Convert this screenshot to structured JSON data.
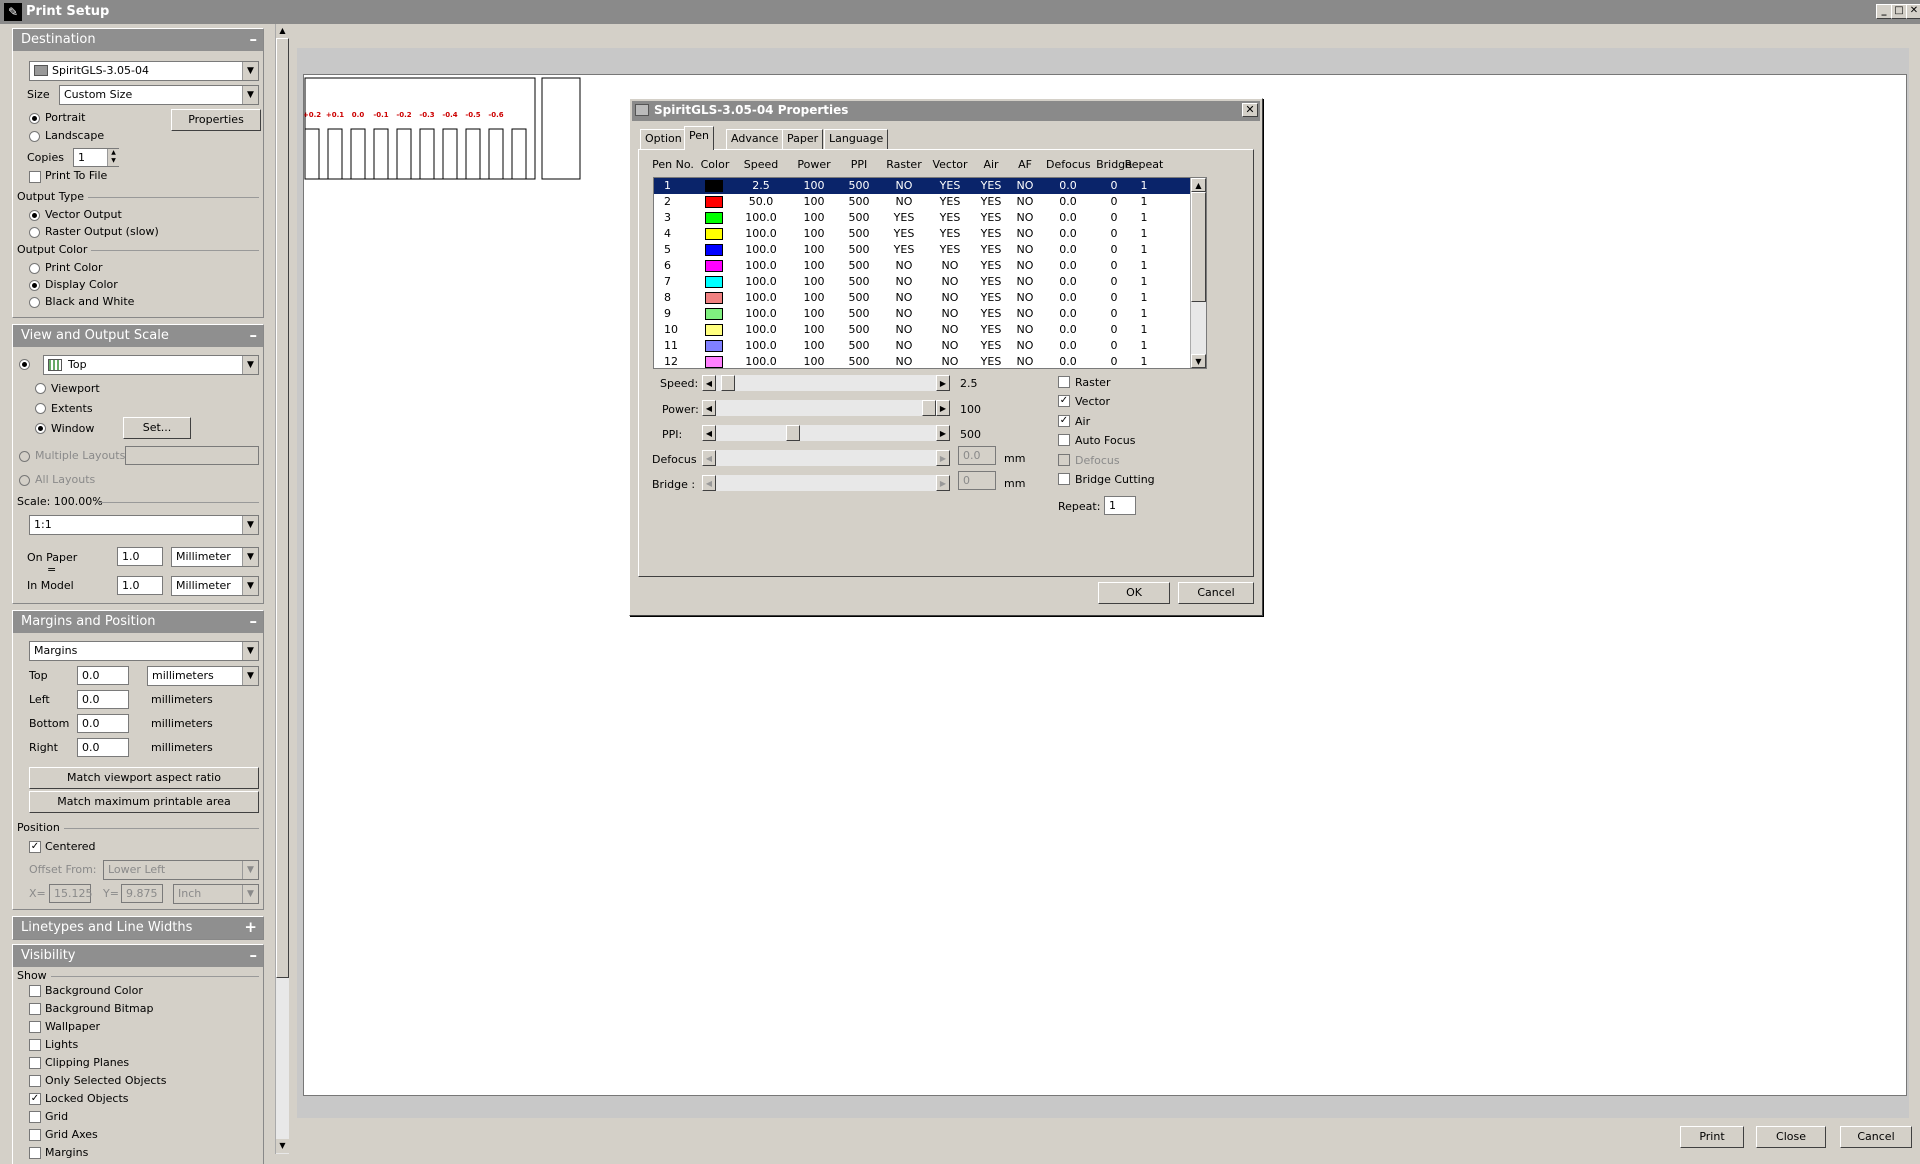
{
  "window": {
    "title": "Print Setup",
    "minimize": "_",
    "maximize": "□",
    "close": "✕"
  },
  "destination": {
    "header": "Destination",
    "toggle": "–",
    "printer": "SpiritGLS-3.05-04",
    "size_label": "Size",
    "size_value": "Custom Size",
    "portrait": "Portrait",
    "landscape": "Landscape",
    "properties_button": "Properties",
    "copies_label": "Copies",
    "copies_value": "1",
    "print_to_file": "Print To File",
    "output_type_label": "Output Type",
    "vector_output": "Vector Output",
    "raster_output": "Raster Output (slow)",
    "output_color_label": "Output Color",
    "print_color": "Print Color",
    "display_color": "Display Color",
    "black_and_white": "Black and White"
  },
  "view": {
    "header": "View and Output Scale",
    "toggle": "–",
    "view_value": "Top",
    "viewport": "Viewport",
    "extents": "Extents",
    "window": "Window",
    "set_button": "Set...",
    "multiple_layouts": "Multiple Layouts",
    "all_layouts": "All Layouts",
    "scale_label": "Scale:  100.00%",
    "scale_value": "1:1",
    "on_paper": "On Paper",
    "equals": "=",
    "in_model": "In Model",
    "on_paper_value": "1.0",
    "on_paper_unit": "Millimeter",
    "in_model_value": "1.0",
    "in_model_unit": "Millimeter"
  },
  "margins": {
    "header": "Margins and Position",
    "toggle": "–",
    "mode": "Margins",
    "top_label": "Top",
    "top_value": "0.0",
    "top_unit": "millimeters",
    "left_label": "Left",
    "left_value": "0.0",
    "left_unit": "millimeters",
    "bottom_label": "Bottom",
    "bottom_value": "0.0",
    "bottom_unit": "millimeters",
    "right_label": "Right",
    "right_value": "0.0",
    "right_unit": "millimeters",
    "match_viewport": "Match viewport aspect ratio",
    "match_max": "Match maximum printable area",
    "position_label": "Position",
    "centered": "Centered",
    "offset_from_label": "Offset From:",
    "offset_from_value": "Lower Left",
    "x_label": "X=",
    "x_value": "15.125",
    "y_label": "Y=",
    "y_value": "9.875",
    "xy_unit": "Inch"
  },
  "linetypes": {
    "header": "Linetypes and Line Widths",
    "toggle": "+"
  },
  "visibility": {
    "header": "Visibility",
    "toggle": "–",
    "show_label": "Show",
    "items": [
      "Background Color",
      "Background Bitmap",
      "Wallpaper",
      "Lights",
      "Clipping Planes",
      "Only Selected Objects",
      "Locked Objects",
      "Grid",
      "Grid Axes",
      "Margins"
    ]
  },
  "preview": {
    "labels": [
      "+0.2",
      "+0.1",
      "0.0",
      "-0.1",
      "-0.2",
      "-0.3",
      "-0.4",
      "-0.5",
      "-0.6"
    ],
    "label_color": "#cc0000"
  },
  "dialog": {
    "title": "SpiritGLS-3.05-04 Properties",
    "close": "✕",
    "tabs": [
      "Option",
      "Pen",
      "Advance",
      "Paper",
      "Language"
    ],
    "columns": [
      "Pen No.",
      "Color",
      "Speed",
      "Power",
      "PPI",
      "Raster",
      "Vector",
      "Air",
      "AF",
      "Defocus",
      "Bridge",
      "Repeat"
    ],
    "rows": [
      {
        "no": "1",
        "color": "#000000",
        "speed": "2.5",
        "power": "100",
        "ppi": "500",
        "raster": "NO",
        "vector": "YES",
        "air": "YES",
        "af": "NO",
        "defocus": "0.0",
        "bridge": "0",
        "repeat": "1"
      },
      {
        "no": "2",
        "color": "#ff0000",
        "speed": "50.0",
        "power": "100",
        "ppi": "500",
        "raster": "NO",
        "vector": "YES",
        "air": "YES",
        "af": "NO",
        "defocus": "0.0",
        "bridge": "0",
        "repeat": "1"
      },
      {
        "no": "3",
        "color": "#00ff00",
        "speed": "100.0",
        "power": "100",
        "ppi": "500",
        "raster": "YES",
        "vector": "YES",
        "air": "YES",
        "af": "NO",
        "defocus": "0.0",
        "bridge": "0",
        "repeat": "1"
      },
      {
        "no": "4",
        "color": "#ffff00",
        "speed": "100.0",
        "power": "100",
        "ppi": "500",
        "raster": "YES",
        "vector": "YES",
        "air": "YES",
        "af": "NO",
        "defocus": "0.0",
        "bridge": "0",
        "repeat": "1"
      },
      {
        "no": "5",
        "color": "#0000ff",
        "speed": "100.0",
        "power": "100",
        "ppi": "500",
        "raster": "YES",
        "vector": "YES",
        "air": "YES",
        "af": "NO",
        "defocus": "0.0",
        "bridge": "0",
        "repeat": "1"
      },
      {
        "no": "6",
        "color": "#ff00ff",
        "speed": "100.0",
        "power": "100",
        "ppi": "500",
        "raster": "NO",
        "vector": "NO",
        "air": "YES",
        "af": "NO",
        "defocus": "0.0",
        "bridge": "0",
        "repeat": "1"
      },
      {
        "no": "7",
        "color": "#00ffff",
        "speed": "100.0",
        "power": "100",
        "ppi": "500",
        "raster": "NO",
        "vector": "NO",
        "air": "YES",
        "af": "NO",
        "defocus": "0.0",
        "bridge": "0",
        "repeat": "1"
      },
      {
        "no": "8",
        "color": "#f08080",
        "speed": "100.0",
        "power": "100",
        "ppi": "500",
        "raster": "NO",
        "vector": "NO",
        "air": "YES",
        "af": "NO",
        "defocus": "0.0",
        "bridge": "0",
        "repeat": "1"
      },
      {
        "no": "9",
        "color": "#80f080",
        "speed": "100.0",
        "power": "100",
        "ppi": "500",
        "raster": "NO",
        "vector": "NO",
        "air": "YES",
        "af": "NO",
        "defocus": "0.0",
        "bridge": "0",
        "repeat": "1"
      },
      {
        "no": "10",
        "color": "#ffff80",
        "speed": "100.0",
        "power": "100",
        "ppi": "500",
        "raster": "NO",
        "vector": "NO",
        "air": "YES",
        "af": "NO",
        "defocus": "0.0",
        "bridge": "0",
        "repeat": "1"
      },
      {
        "no": "11",
        "color": "#8080ff",
        "speed": "100.0",
        "power": "100",
        "ppi": "500",
        "raster": "NO",
        "vector": "NO",
        "air": "YES",
        "af": "NO",
        "defocus": "0.0",
        "bridge": "0",
        "repeat": "1"
      },
      {
        "no": "12",
        "color": "#ff80ff",
        "speed": "100.0",
        "power": "100",
        "ppi": "500",
        "raster": "NO",
        "vector": "NO",
        "air": "YES",
        "af": "NO",
        "defocus": "0.0",
        "bridge": "0",
        "repeat": "1"
      }
    ],
    "speed_label": "Speed:",
    "speed_value": "2.5",
    "speed_level": 0.025,
    "power_label": "Power:",
    "power_value": "100",
    "power_level": 1.0,
    "ppi_label": "PPI:",
    "ppi_value": "500",
    "ppi_level": 0.34,
    "defocus_label": "Defocus",
    "defocus_value": "0.0",
    "defocus_unit": "mm",
    "bridge_label": "Bridge :",
    "bridge_value": "0",
    "bridge_unit": "mm",
    "raster": "Raster",
    "vector": "Vector",
    "air": "Air",
    "auto_focus": "Auto Focus",
    "defocus_chk": "Defocus",
    "bridge_cutting": "Bridge Cutting",
    "repeat_label": "Repeat:",
    "repeat_value": "1",
    "ok": "OK",
    "cancel": "Cancel"
  },
  "footer": {
    "print": "Print",
    "close": "Close",
    "cancel": "Cancel"
  }
}
